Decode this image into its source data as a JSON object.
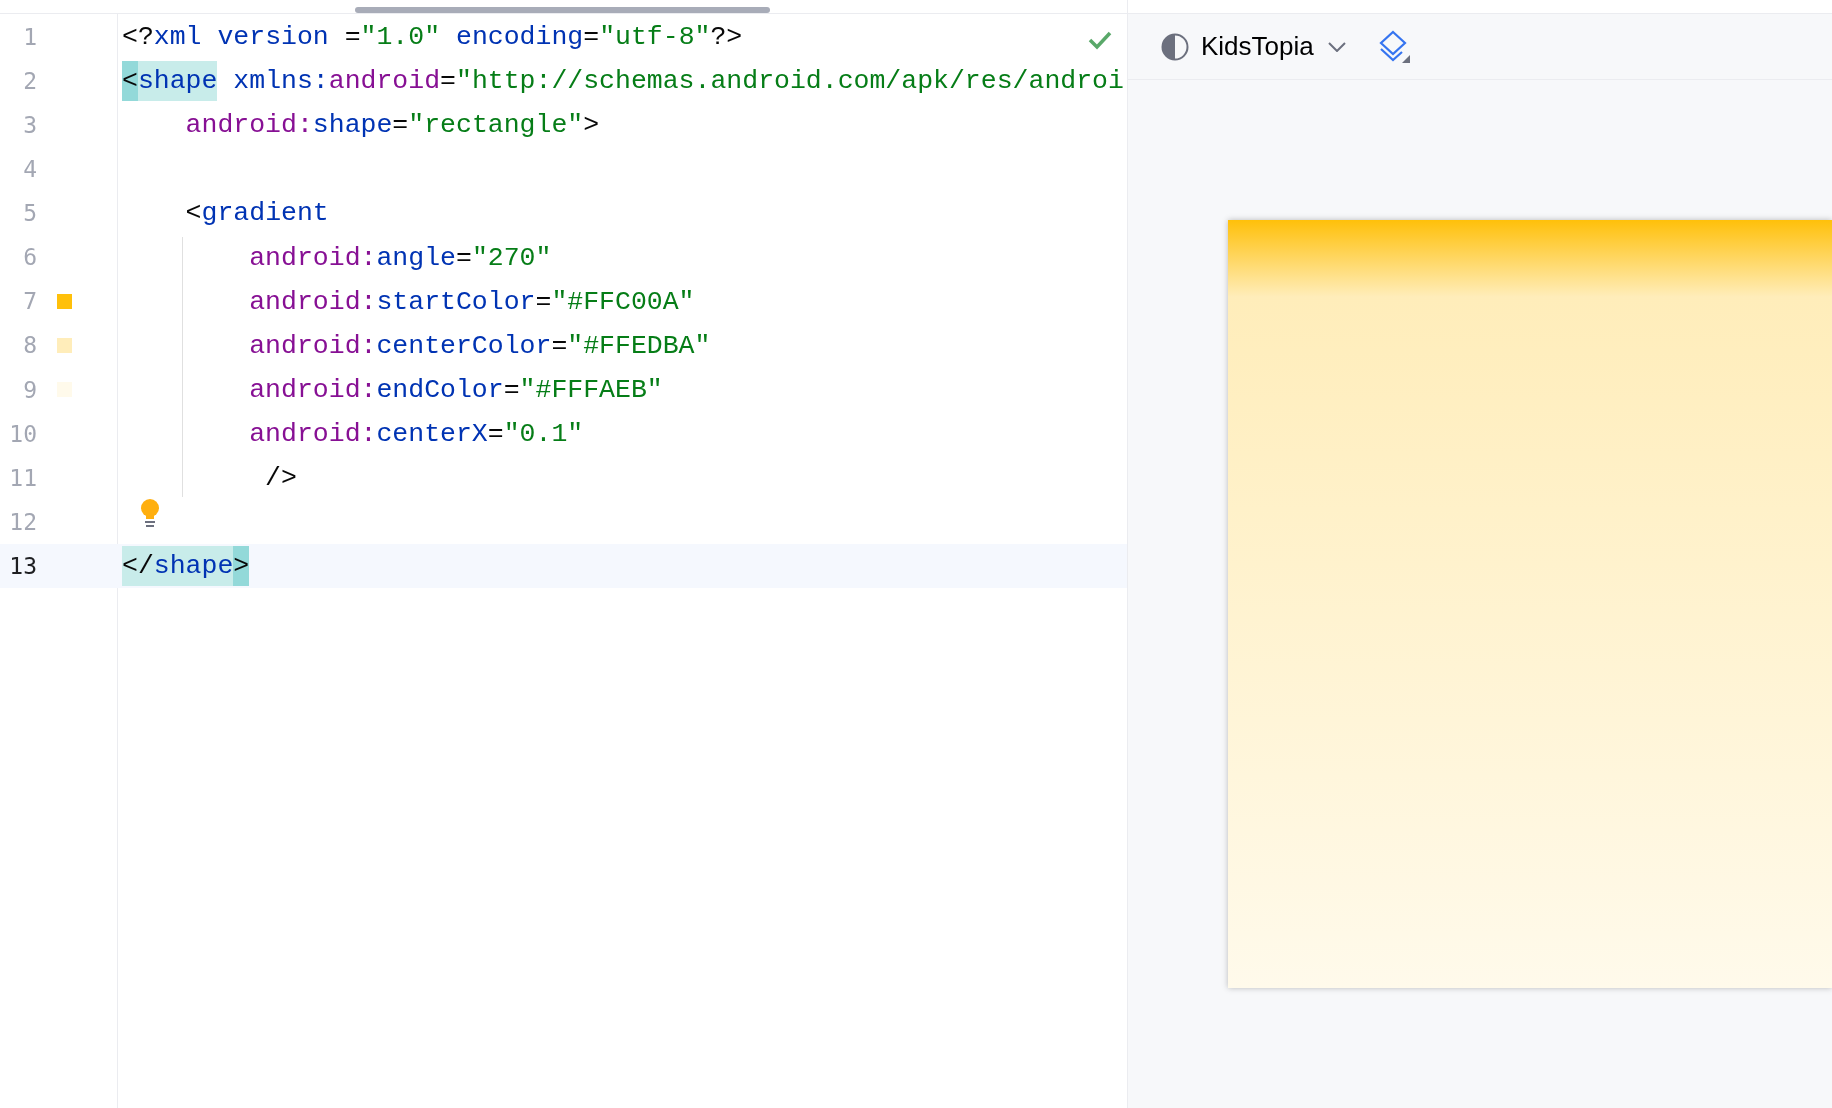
{
  "editor": {
    "lines": [
      {
        "number": "1",
        "current": false,
        "tokens": [
          {
            "text": "<?",
            "kind": "punct"
          },
          {
            "text": "xml version ",
            "kind": "tag"
          },
          {
            "text": "=",
            "kind": "punct"
          },
          {
            "text": "\"1.0\" ",
            "kind": "value"
          },
          {
            "text": "encoding",
            "kind": "tag"
          },
          {
            "text": "=",
            "kind": "punct"
          },
          {
            "text": "\"utf-8\"",
            "kind": "value"
          },
          {
            "text": "?>",
            "kind": "punct"
          }
        ]
      },
      {
        "number": "2",
        "current": false,
        "tokens": [
          {
            "text": "<",
            "kind": "punct",
            "matched": true,
            "at_caret": true
          },
          {
            "text": "shape",
            "kind": "tag",
            "matched": true,
            "at_caret": false
          },
          {
            "text": " xmlns:",
            "kind": "tag"
          },
          {
            "text": "android",
            "kind": "ns"
          },
          {
            "text": "=",
            "kind": "punct"
          },
          {
            "text": "\"http://schemas.android.com/apk/res/androi",
            "kind": "value"
          }
        ]
      },
      {
        "number": "3",
        "current": false,
        "tokens": [
          {
            "text": "    android:",
            "kind": "ns"
          },
          {
            "text": "shape",
            "kind": "tag"
          },
          {
            "text": "=",
            "kind": "punct"
          },
          {
            "text": "\"rectangle\"",
            "kind": "value"
          },
          {
            "text": ">",
            "kind": "punct"
          }
        ]
      },
      {
        "number": "4",
        "current": false
      },
      {
        "number": "5",
        "current": false,
        "tokens": [
          {
            "text": "    <",
            "kind": "punct"
          },
          {
            "text": "gradient",
            "kind": "tag"
          }
        ]
      },
      {
        "number": "6",
        "current": false,
        "tokens": [
          {
            "text": "        android:",
            "kind": "ns"
          },
          {
            "text": "angle",
            "kind": "tag"
          },
          {
            "text": "=",
            "kind": "punct"
          },
          {
            "text": "\"270\"",
            "kind": "value"
          }
        ]
      },
      {
        "number": "7",
        "current": false,
        "color": "#ffc00a",
        "tokens": [
          {
            "text": "        android:",
            "kind": "ns"
          },
          {
            "text": "startColor",
            "kind": "tag"
          },
          {
            "text": "=",
            "kind": "punct"
          },
          {
            "text": "\"#FFC00A\"",
            "kind": "value"
          }
        ]
      },
      {
        "number": "8",
        "current": false,
        "color": "#ffedba",
        "tokens": [
          {
            "text": "        android:",
            "kind": "ns"
          },
          {
            "text": "centerColor",
            "kind": "tag"
          },
          {
            "text": "=",
            "kind": "punct"
          },
          {
            "text": "\"#FFEDBA\"",
            "kind": "value"
          }
        ]
      },
      {
        "number": "9",
        "current": false,
        "color": "#fffaeb",
        "tokens": [
          {
            "text": "        android:",
            "kind": "ns"
          },
          {
            "text": "endColor",
            "kind": "tag"
          },
          {
            "text": "=",
            "kind": "punct"
          },
          {
            "text": "\"#FFFAEB\"",
            "kind": "value"
          }
        ]
      },
      {
        "number": "10",
        "current": false,
        "tokens": [
          {
            "text": "        android:",
            "kind": "ns"
          },
          {
            "text": "centerX",
            "kind": "tag"
          },
          {
            "text": "=",
            "kind": "punct"
          },
          {
            "text": "\"0.1\"",
            "kind": "value"
          }
        ]
      },
      {
        "number": "11",
        "current": false,
        "tokens": [
          {
            "text": "         />",
            "kind": "punct"
          }
        ]
      },
      {
        "number": "12",
        "current": false,
        "bulb": true
      },
      {
        "number": "13",
        "current": true,
        "tokens": [
          {
            "text": "</",
            "kind": "punct",
            "matched": true,
            "at_caret": false
          },
          {
            "text": "shape",
            "kind": "tag",
            "matched": true,
            "at_caret": false
          },
          {
            "text": ">",
            "kind": "punct",
            "matched": true,
            "at_caret": true
          }
        ]
      }
    ]
  },
  "preview": {
    "theme": "KidsTopia"
  }
}
